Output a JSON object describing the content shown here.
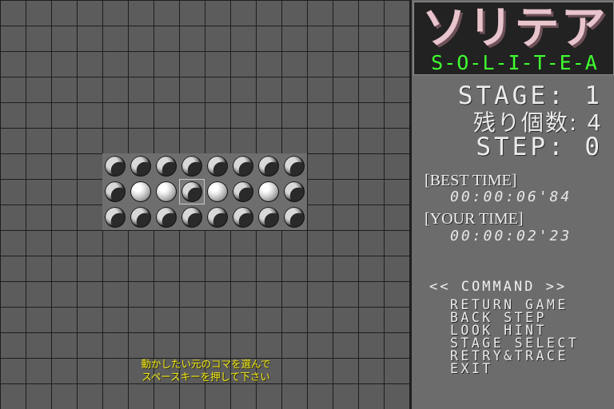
{
  "board": {
    "rows": [
      [
        "dark",
        "dark",
        "dark",
        "dark",
        "dark",
        "dark",
        "dark",
        "dark"
      ],
      [
        "dark",
        "light",
        "light",
        "cursor",
        "light",
        "dark",
        "light",
        "dark"
      ],
      [
        "dark",
        "dark",
        "dark",
        "dark",
        "dark",
        "dark",
        "dark",
        "dark"
      ]
    ]
  },
  "instruction": {
    "line1": "動かしたい元のコマを選んで",
    "line2": "スペースキーを押して下さい"
  },
  "logo": {
    "kana": "ソリテア",
    "roman": "S-O-L-I-T-E-A"
  },
  "stats": {
    "stage": "STAGE: 1",
    "remaining": "残り個数: 4",
    "step": "STEP: 0"
  },
  "times": {
    "best_label": "[BEST TIME]",
    "best_value": "00:00:06'84",
    "your_label": "[YOUR TIME]",
    "your_value": "00:00:02'23"
  },
  "command": {
    "title": "<< COMMAND >>",
    "items": [
      "RETURN GAME",
      "BACK STEP",
      "LOOK HINT",
      "STAGE SELECT",
      "RETRY&TRACE",
      "EXIT"
    ]
  },
  "colors": {
    "instruction": "#f0e820",
    "logo_kana": "#e8c4cc",
    "logo_roman": "#40ff30",
    "board_bg": "#5c5c5c",
    "grid_line": "#1e1e1e"
  }
}
